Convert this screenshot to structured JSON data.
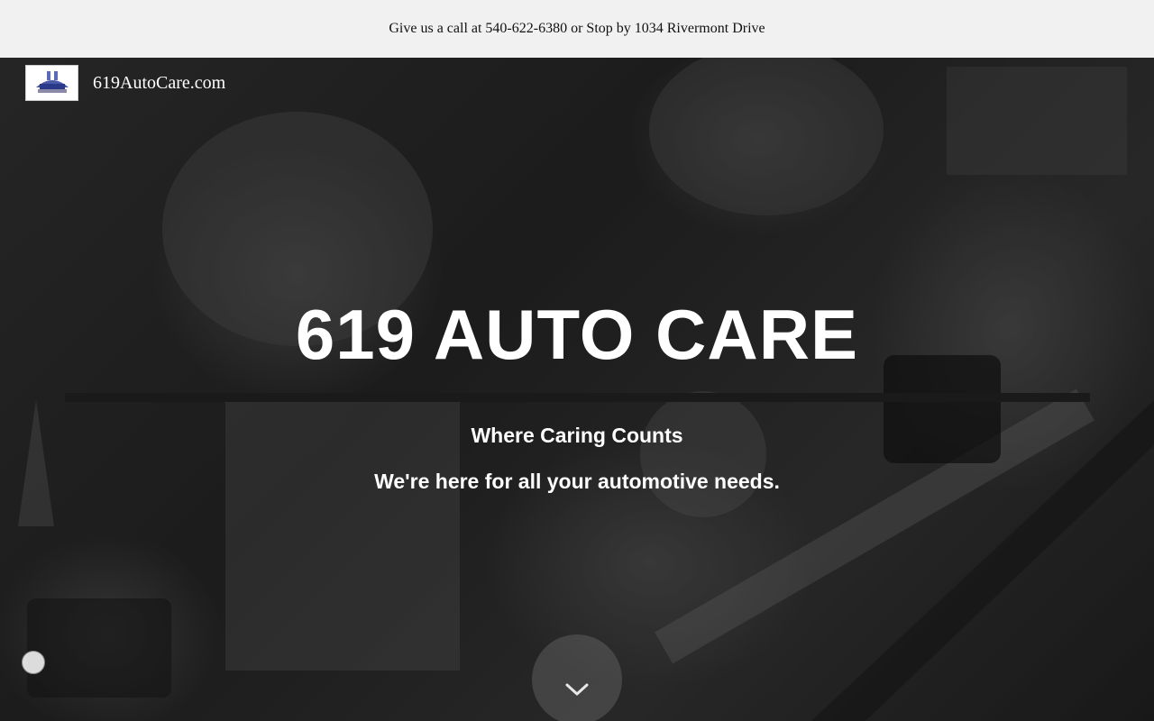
{
  "announcement": {
    "text": "Give us a call at 540-622-6380 or Stop by 1034 Rivermont Drive"
  },
  "header": {
    "site_title": "619AutoCare.com",
    "logo_icon": "619-auto-care-logo"
  },
  "hero": {
    "title": "619 AUTO CARE",
    "tagline": "Where Caring Counts",
    "subtext": "We're here for all your automotive needs.",
    "scroll_icon": "chevron-down-icon",
    "background_description_color": "#2f2f2f"
  },
  "colors": {
    "announcement_bg": "#f1f1f1",
    "hero_text": "#ffffff",
    "rule": "#1a1a1a"
  }
}
